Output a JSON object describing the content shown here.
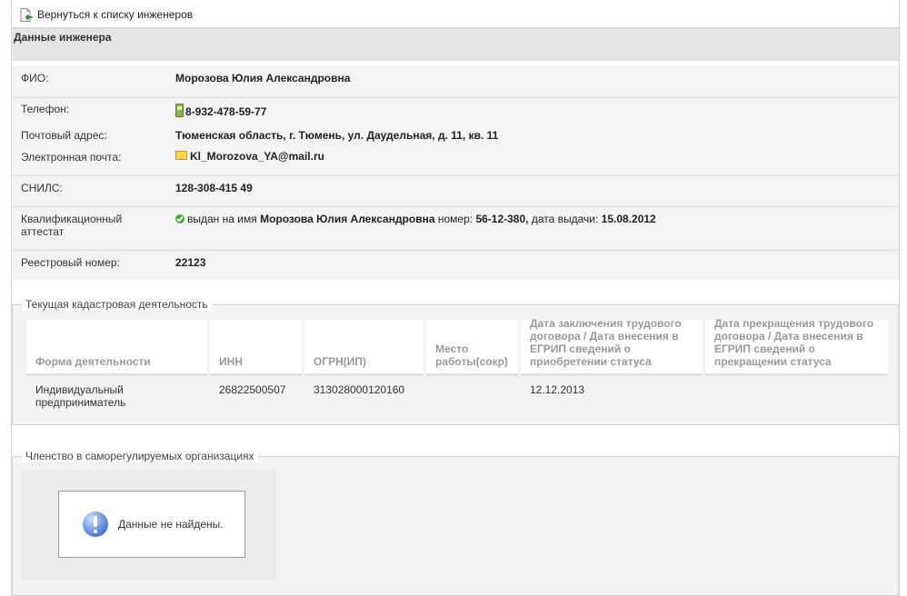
{
  "nav": {
    "back_label": "Вернуться к списку инженеров"
  },
  "section": {
    "title": "Данные инженера"
  },
  "engineer": {
    "fio_label": "ФИО:",
    "fio": "Морозова Юлия Александровна",
    "phone_label": "Телефон:",
    "phone": "8-932-478-59-77",
    "address_label": "Почтовый адрес:",
    "address": "Тюменская область, г. Тюмень, ул. Даудельная, д. 11, кв. 11",
    "email_label": "Электронная почта:",
    "email": "Kl_Morozova_YA@mail.ru",
    "snils_label": "СНИЛС:",
    "snils": "128-308-415 49",
    "attest_label_line1": "Квалификационный",
    "attest_label_line2": "аттестат",
    "attest_prefix": "выдан на имя",
    "attest_name": "Морозова Юлия Александровна",
    "attest_number_label": "номер:",
    "attest_number": "56-12-380,",
    "attest_date_label": "дата выдачи:",
    "attest_date": "15.08.2012",
    "registry_label": "Реестровый номер:",
    "registry": "22123"
  },
  "cadastral": {
    "legend": "Текущая кадастровая деятельность",
    "columns": [
      "Форма деятельности",
      "ИНН",
      "ОГРН(ИП)",
      "Место работы(сокр)",
      "Дата заключения трудового договора / Дата внесения в ЕГРИП сведений о приобретении статуса",
      "Дата прекращения трудового договора / Дата внесения в ЕГРИП сведений о прекращении статуса"
    ],
    "rows": [
      [
        "Индивидуальный предприниматель",
        "26822500507",
        "313028000120160",
        "",
        "12.12.2013",
        ""
      ]
    ]
  },
  "membership": {
    "legend": "Членство в саморегулируемых организациях",
    "empty_message": "Данные не найдены."
  },
  "colors": {
    "header_bg": "#e4e4e4",
    "panel_bg": "#f4f4f4",
    "ok_icon": "#3cae3c"
  }
}
